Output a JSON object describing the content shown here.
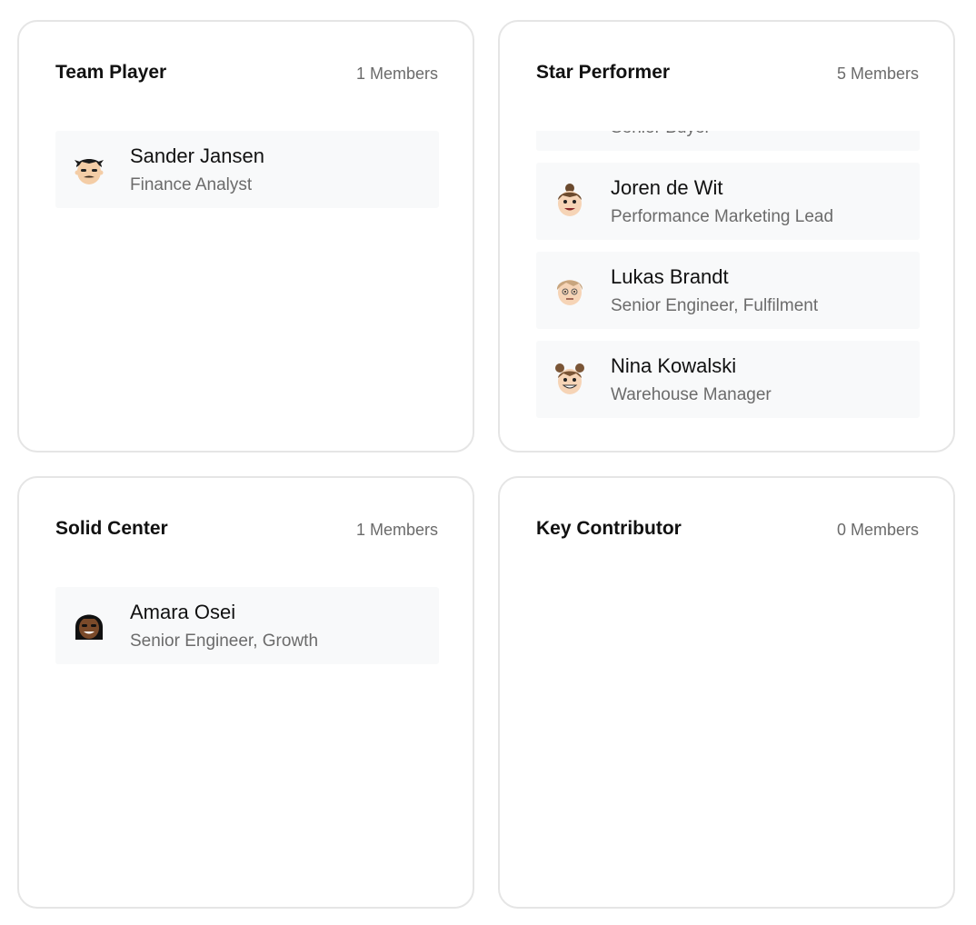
{
  "groups": [
    {
      "title": "Team Player",
      "count": "1 Members",
      "members": [
        {
          "name": "Sander Jansen",
          "role": "Finance Analyst",
          "avatar": "avatar-dark-hair-mustache-icon"
        }
      ]
    },
    {
      "title": "Star Performer",
      "count": "5 Members",
      "members": [
        {
          "name": "",
          "role": "Senior Buyer",
          "avatar": "avatar-orange-hair-icon"
        },
        {
          "name": "Joren de Wit",
          "role": "Performance Marketing Lead",
          "avatar": "avatar-bun-smile-icon"
        },
        {
          "name": "Lukas Brandt",
          "role": "Senior Engineer, Fulfilment",
          "avatar": "avatar-blond-hair-icon"
        },
        {
          "name": "Nina Kowalski",
          "role": "Warehouse Manager",
          "avatar": "avatar-buns-grin-icon"
        }
      ]
    },
    {
      "title": "Solid Center",
      "count": "1 Members",
      "members": [
        {
          "name": "Amara Osei",
          "role": "Senior Engineer, Growth",
          "avatar": "avatar-long-dark-hair-icon"
        }
      ]
    },
    {
      "title": "Key Contributor",
      "count": "0 Members",
      "members": []
    }
  ]
}
